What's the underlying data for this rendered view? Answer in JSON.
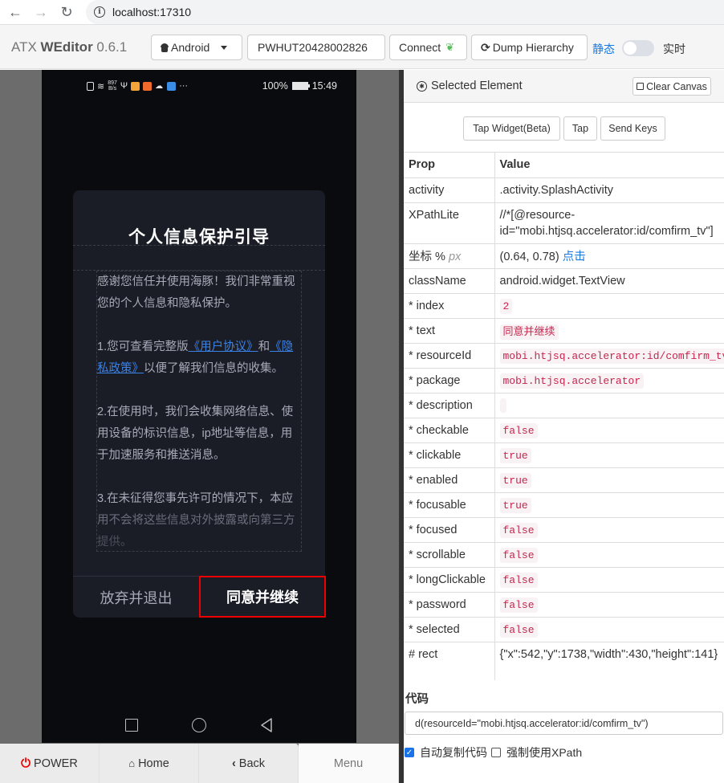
{
  "browser": {
    "url": "localhost:17310"
  },
  "header": {
    "brand_prefix": "ATX ",
    "brand_name": "WEditor",
    "brand_version": " 0.6.1",
    "platform": "Android",
    "serial": "PWHUT20428002826",
    "connect_label": "Connect",
    "dump_label": "Dump Hierarchy",
    "mode_static": "静态",
    "mode_live": "实时",
    "live_enabled": false
  },
  "phone": {
    "status_bar": {
      "net_speed_value": "897",
      "net_speed_unit": "B/s",
      "battery": "100%",
      "time": "15:49"
    },
    "dialog": {
      "title": "个人信息保护引导",
      "p1": "感谢您信任并使用海豚！我们非常重视您的个人信息和隐私保护。",
      "p2_before": "1.您可查看完整版",
      "p2_link1": "《用户协议》",
      "p2_mid": "和",
      "p2_link2": "《隐私政策》",
      "p2_after": "以便了解我们信息的收集。",
      "p3": "2.在使用时，我们会收集网络信息、使用设备的标识信息，ip地址等信息，用于加速服务和推送消息。",
      "p4_visible": "3.在未征得您事先许可的情况下，本应",
      "p4_faded": "用不会将这些信息对外披露或向第三方",
      "p4_fading": "提供。",
      "decline": "放弃并退出",
      "accept": "同意并继续"
    }
  },
  "bottom_bar": {
    "power": "POWER",
    "home": "Home",
    "back": "Back",
    "menu": "Menu"
  },
  "inspector": {
    "title": "Selected Element",
    "clear_canvas": "Clear Canvas",
    "tap_widget": "Tap Widget(Beta)",
    "tap": "Tap",
    "send_keys": "Send Keys",
    "col_prop": "Prop",
    "col_value": "Value",
    "rows": {
      "activity": {
        "prop": "activity",
        "value": ".activity.SplashActivity"
      },
      "xpath": {
        "prop": "XPathLite",
        "value": "//*[@resource-id=\"mobi.htjsq.accelerator:id/comfirm_tv\"]"
      },
      "coord": {
        "prop": "坐标 %",
        "prop_unit": "px",
        "value": "(0.64, 0.78)",
        "action": "点击"
      },
      "className": {
        "prop": "className",
        "value": "android.widget.TextView"
      },
      "index": {
        "prop": "* index",
        "value": "2"
      },
      "text": {
        "prop": "* text",
        "value": "同意并继续"
      },
      "resourceId": {
        "prop": "* resourceId",
        "value": "mobi.htjsq.accelerator:id/comfirm_tv"
      },
      "package": {
        "prop": "* package",
        "value": "mobi.htjsq.accelerator"
      },
      "description": {
        "prop": "* description",
        "value": ""
      },
      "checkable": {
        "prop": "* checkable",
        "value": "false"
      },
      "clickable": {
        "prop": "* clickable",
        "value": "true"
      },
      "enabled": {
        "prop": "* enabled",
        "value": "true"
      },
      "focusable": {
        "prop": "* focusable",
        "value": "true"
      },
      "focused": {
        "prop": "* focused",
        "value": "false"
      },
      "scrollable": {
        "prop": "* scrollable",
        "value": "false"
      },
      "longClickable": {
        "prop": "* longClickable",
        "value": "false"
      },
      "password": {
        "prop": "* password",
        "value": "false"
      },
      "selected": {
        "prop": "* selected",
        "value": "false"
      },
      "rect": {
        "prop": "# rect",
        "value": "{\"x\":542,\"y\":1738,\"width\":430,\"height\":141}"
      }
    },
    "code_label": "代码",
    "code_value": "d(resourceId=\"mobi.htjsq.accelerator:id/comfirm_tv\")",
    "auto_copy_label": "自动复制代码",
    "auto_copy_checked": true,
    "force_xpath_label": "强制使用XPath",
    "force_xpath_checked": false
  },
  "colors": {
    "accent_blue": "#1a7ae0",
    "highlight_red": "#ee0000",
    "code_red": "#c7254e",
    "power_red": "#ee0000"
  }
}
